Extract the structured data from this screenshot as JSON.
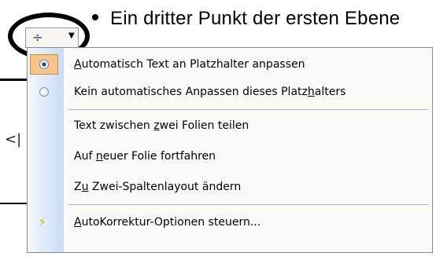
{
  "slide": {
    "bullet_text": "Ein dritter Punkt der ersten Ebene",
    "edge_mark": "<|"
  },
  "smart_tag": {
    "icon": "autofit-options-icon",
    "dropdown_icon": "dropdown-arrow-icon",
    "glyph": "÷",
    "arrow": "▼"
  },
  "menu": {
    "items": [
      {
        "pre": "",
        "key": "A",
        "post": "utomatisch Text an Platzhalter anpassen",
        "type": "radio",
        "checked": true
      },
      {
        "pre": "Kein automatisches Anpassen dieses Platz",
        "key": "h",
        "post": "alters",
        "type": "radio",
        "checked": false
      },
      {
        "pre": "Text zwischen ",
        "key": "z",
        "post": "wei Folien teilen",
        "type": "plain"
      },
      {
        "pre": "Auf ",
        "key": "n",
        "post": "euer Folie fortfahren",
        "type": "plain"
      },
      {
        "pre": "Z",
        "key": "u",
        "post": " Zwei-Spaltenlayout ändern",
        "type": "plain"
      },
      {
        "pre": "",
        "key": "A",
        "post": "utoKorrektur-Optionen steuern...",
        "type": "icon",
        "icon": "lightning-bolt-icon"
      }
    ]
  }
}
